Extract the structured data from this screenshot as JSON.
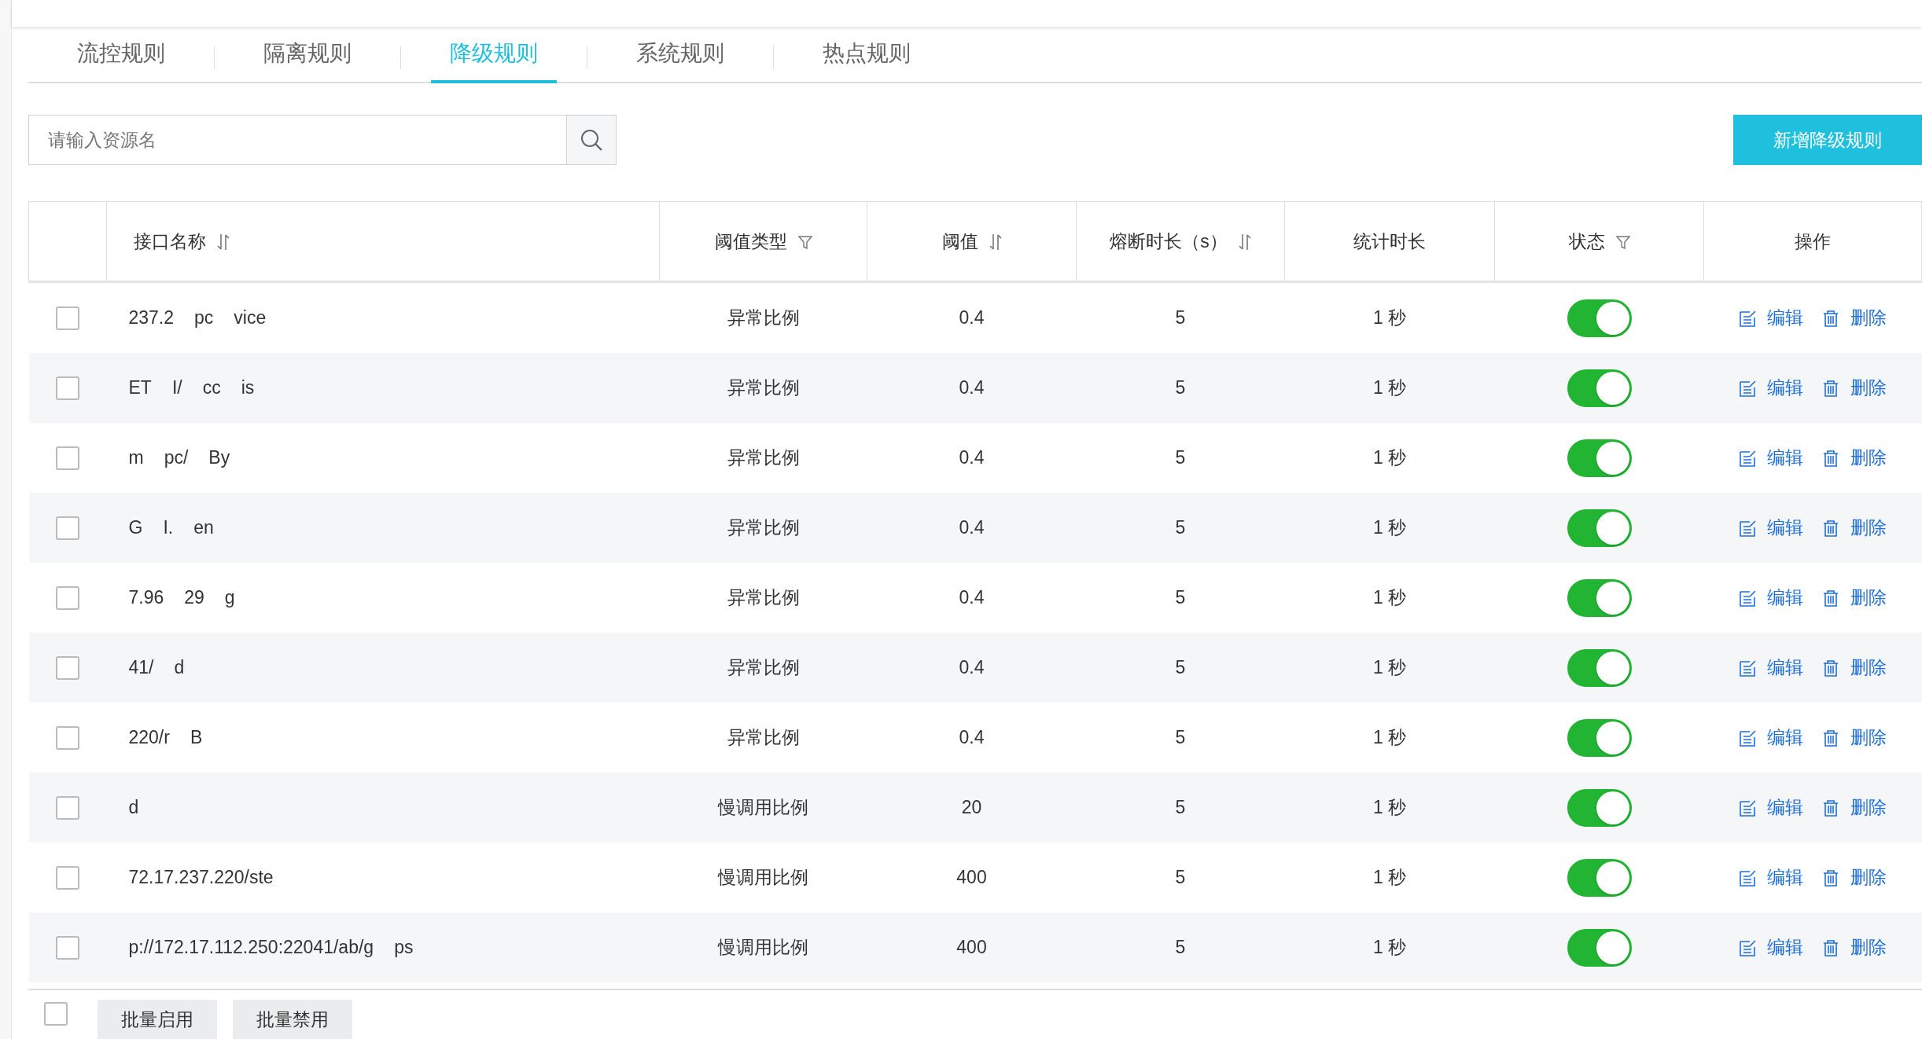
{
  "tabs": [
    {
      "label": "流控规则",
      "selected": false
    },
    {
      "label": "隔离规则",
      "selected": false
    },
    {
      "label": "降级规则",
      "selected": true
    },
    {
      "label": "系统规则",
      "selected": false
    },
    {
      "label": "热点规则",
      "selected": false
    }
  ],
  "search": {
    "placeholder": "请输入资源名"
  },
  "add_button": "新增降级规则",
  "table": {
    "columns": [
      {
        "label": "接口名称",
        "kind": "sortable"
      },
      {
        "label": "阈值类型",
        "kind": "filterable"
      },
      {
        "label": "阈值",
        "kind": "sortable"
      },
      {
        "label": "熔断时长（s）",
        "kind": "sortable"
      },
      {
        "label": "统计时长",
        "kind": "plain"
      },
      {
        "label": "状态",
        "kind": "filterable"
      },
      {
        "label": "操作",
        "kind": "plain"
      }
    ],
    "rows": [
      {
        "checked": false,
        "name_fragments": [
          "237.2",
          "pc",
          "vice"
        ],
        "type": "异常比例",
        "threshold": "0.4",
        "duration": "5",
        "window": "1 秒",
        "on": true,
        "actions": [
          "编辑",
          "删除"
        ]
      },
      {
        "checked": false,
        "name_fragments": [
          "ET",
          "I/",
          "cc",
          "is"
        ],
        "type": "异常比例",
        "threshold": "0.4",
        "duration": "5",
        "window": "1 秒",
        "on": true,
        "actions": [
          "编辑",
          "删除"
        ]
      },
      {
        "checked": false,
        "name_fragments": [
          "m",
          "pc/",
          "By"
        ],
        "type": "异常比例",
        "threshold": "0.4",
        "duration": "5",
        "window": "1 秒",
        "on": true,
        "actions": [
          "编辑",
          "删除"
        ]
      },
      {
        "checked": false,
        "name_fragments": [
          "G",
          "I.",
          "en"
        ],
        "type": "异常比例",
        "threshold": "0.4",
        "duration": "5",
        "window": "1 秒",
        "on": true,
        "actions": [
          "编辑",
          "删除"
        ]
      },
      {
        "checked": false,
        "name_fragments": [
          "7.96",
          "29",
          "g"
        ],
        "type": "异常比例",
        "threshold": "0.4",
        "duration": "5",
        "window": "1 秒",
        "on": true,
        "actions": [
          "编辑",
          "删除"
        ]
      },
      {
        "checked": false,
        "name_fragments": [
          "41/",
          "d"
        ],
        "type": "异常比例",
        "threshold": "0.4",
        "duration": "5",
        "window": "1 秒",
        "on": true,
        "actions": [
          "编辑",
          "删除"
        ]
      },
      {
        "checked": false,
        "name_fragments": [
          "220/r",
          "B"
        ],
        "type": "异常比例",
        "threshold": "0.4",
        "duration": "5",
        "window": "1 秒",
        "on": true,
        "actions": [
          "编辑",
          "删除"
        ]
      },
      {
        "checked": false,
        "name_fragments": [
          "d"
        ],
        "type": "慢调用比例",
        "threshold": "20",
        "duration": "5",
        "window": "1 秒",
        "on": true,
        "actions": [
          "编辑",
          "删除"
        ]
      },
      {
        "checked": false,
        "name_fragments": [
          "72.17.237.220/ste"
        ],
        "type": "慢调用比例",
        "threshold": "400",
        "duration": "5",
        "window": "1 秒",
        "on": true,
        "actions": [
          "编辑",
          "删除"
        ]
      },
      {
        "checked": false,
        "name_fragments": [
          "p://172.17.112.250:22041/ab/g",
          "ps"
        ],
        "type": "慢调用比例",
        "threshold": "400",
        "duration": "5",
        "window": "1 秒",
        "on": true,
        "actions": [
          "编辑",
          "删除"
        ]
      }
    ]
  },
  "footer": {
    "select_all_checked": false,
    "buttons": [
      "批量启用",
      "批量禁用"
    ]
  }
}
